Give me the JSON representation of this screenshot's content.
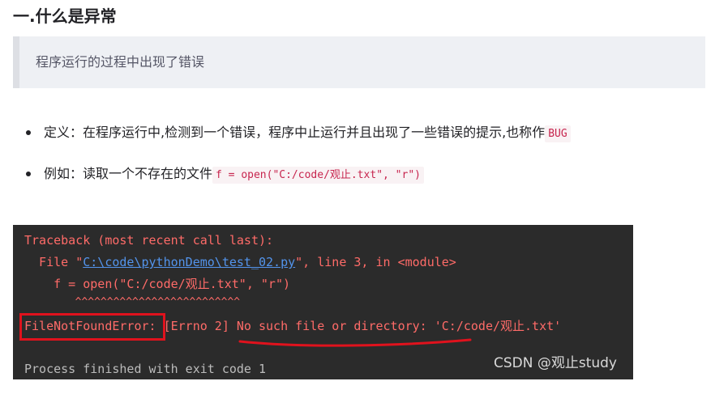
{
  "heading": "一.什么是异常",
  "quote": "程序运行的过程中出现了错误",
  "bullets": [
    {
      "text": "定义：在程序运行中,检测到一个错误，程序中止运行并且出现了一些错误的提示,也称作",
      "code": "BUG"
    },
    {
      "text": "例如：读取一个不存在的文件",
      "code": "f = open(\"C:/code/观止.txt\", \"r\")"
    }
  ],
  "terminal": {
    "top_fragment": "                        ",
    "line1": "Traceback (most recent call last):",
    "line2_prefix": "  File \"",
    "line2_link": "C:\\code\\pythonDemo\\test_02.py",
    "line2_suffix": "\", line 3, in <module>",
    "line3": "    f = open(\"C:/code/观止.txt\", \"r\")",
    "line4": "        ^^^^^^^^^^^^^^^^^^^^^^^^^^",
    "line5_error": "FileNotFoundError:",
    "line5_rest": " [Errno 2] No such file or directory: 'C:/code/观止.txt'",
    "line6": "Process finished with exit code 1",
    "watermark": "CSDN @观止study",
    "annotation_color": "#e0121d"
  }
}
